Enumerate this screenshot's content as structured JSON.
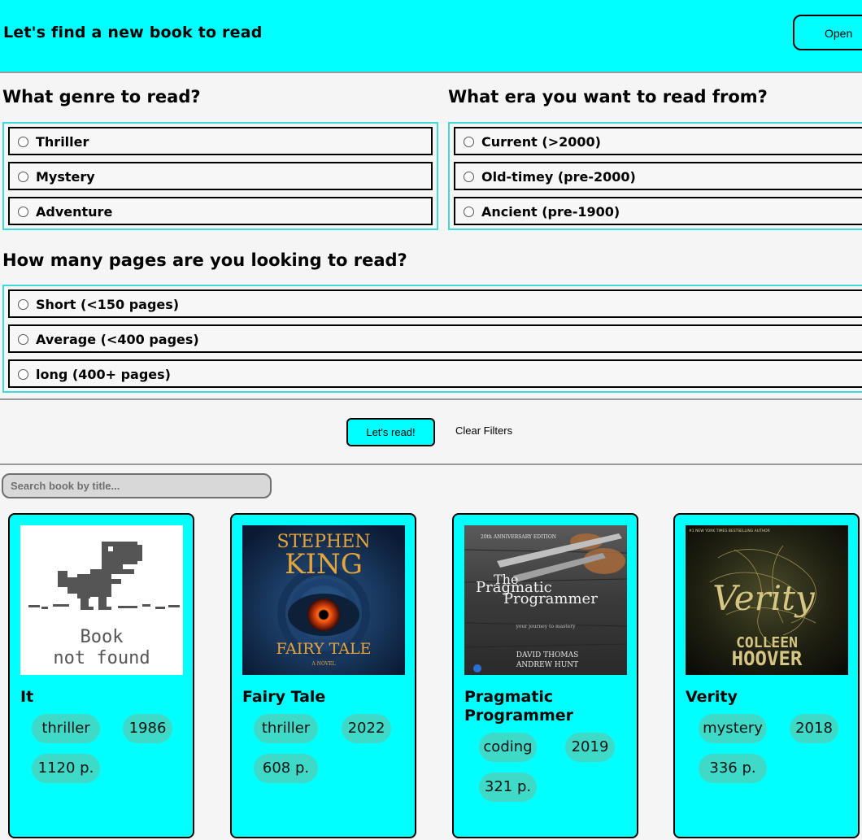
{
  "header": {
    "title": "Let's find a new book to read",
    "open_label": "Open"
  },
  "genre": {
    "title": "What genre to read?",
    "options": [
      "Thriller",
      "Mystery",
      "Adventure"
    ]
  },
  "era": {
    "title": "What era you want to read from?",
    "options": [
      "Current (>2000)",
      "Old-timey (pre-2000)",
      "Ancient (pre-1900)"
    ]
  },
  "pages": {
    "title": "How many pages are you looking to read?",
    "options": [
      "Short (<150 pages)",
      "Average (<400 pages)",
      "long (400+ pages)"
    ]
  },
  "actions": {
    "read_label": "Let's read!",
    "clear_label": "Clear Filters"
  },
  "search": {
    "placeholder": "Search book by title..."
  },
  "books": [
    {
      "title": "It",
      "genre": "thriller",
      "year": "1986",
      "pages": "1120 p.",
      "cover": {
        "line1": "Book",
        "line2": "not found"
      }
    },
    {
      "title": "Fairy Tale",
      "genre": "thriller",
      "year": "2022",
      "pages": "608 p.",
      "cover": {
        "author": "STEPHEN KING",
        "author_line1": "STEPHEN",
        "author_line2": "KING",
        "name": "FAIRY TALE",
        "subtitle": "A NOVEL"
      }
    },
    {
      "title": "Pragmatic Programmer",
      "genre": "coding",
      "year": "2019",
      "pages": "321 p.",
      "cover": {
        "edition": "20th ANNIVERSARY EDITION",
        "name_line1": "The",
        "name_line2": "Pragmatic",
        "name_line3": "Programmer",
        "tagline": "your journey to mastery",
        "author1": "DAVID THOMAS",
        "author2": "ANDREW HUNT"
      }
    },
    {
      "title": "Verity",
      "genre": "mystery",
      "year": "2018",
      "pages": "336 p.",
      "cover": {
        "blurb": "#1 NEW YORK TIMES BESTSELLING AUTHOR",
        "name": "Verity",
        "author_line1": "COLLEEN",
        "author_line2": "HOOVER"
      }
    }
  ],
  "colors": {
    "accent": "#00ffff",
    "tag": "#3fd9c8",
    "group_border": "#40d8d8"
  }
}
